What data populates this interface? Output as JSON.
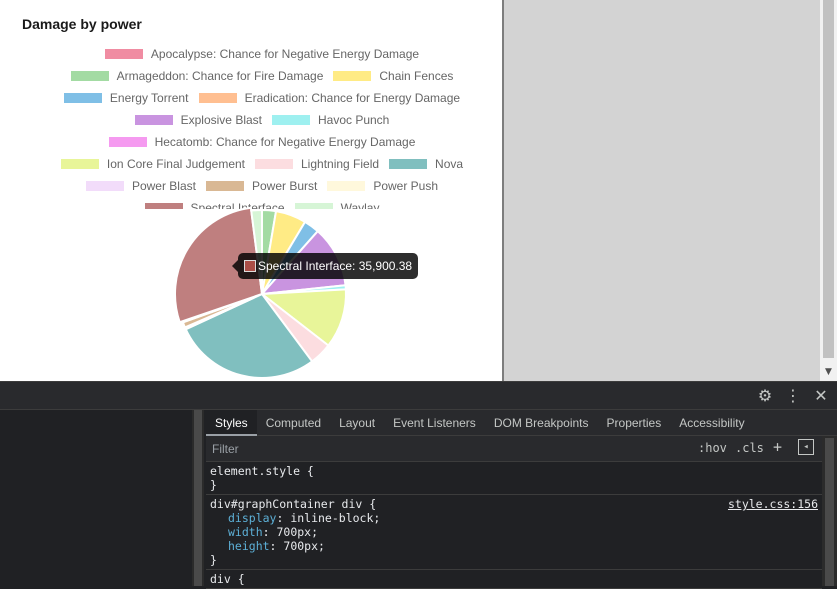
{
  "chart_data": {
    "type": "pie",
    "title": "Damage by power",
    "legend_placement": "top",
    "series": [
      {
        "name": "Apocalypse: Chance for Negative Energy Damage",
        "value": 0,
        "color": "#f08ca2"
      },
      {
        "name": "Armageddon: Chance for Fire Damage",
        "value": 3400,
        "color": "#a3dba3"
      },
      {
        "name": "Chain Fences",
        "value": 7500,
        "color": "#ffeb85"
      },
      {
        "name": "Energy Torrent",
        "value": 3800,
        "color": "#7fbfe6"
      },
      {
        "name": "Eradication: Chance for Energy Damage",
        "value": 0,
        "color": "#ffbf91"
      },
      {
        "name": "Explosive Blast",
        "value": 15000,
        "color": "#c994e0"
      },
      {
        "name": "Havoc Punch",
        "value": 1000,
        "color": "#9ef0f0"
      },
      {
        "name": "Hecatomb: Chance for Negative Energy Damage",
        "value": 0,
        "color": "#f59af0"
      },
      {
        "name": "Ion Core Final Judgement",
        "value": 14500,
        "color": "#e8f599"
      },
      {
        "name": "Lightning Field",
        "value": 5500,
        "color": "#fcdde0"
      },
      {
        "name": "Nova",
        "value": 36000,
        "color": "#80bfbf"
      },
      {
        "name": "Power Blast",
        "value": 500,
        "color": "#f2dcfa"
      },
      {
        "name": "Power Burst",
        "value": 1300,
        "color": "#d9b894"
      },
      {
        "name": "Power Push",
        "value": 300,
        "color": "#fff8dc"
      },
      {
        "name": "Spectral Interface",
        "value": 35900.38,
        "color": "#bf7f7f"
      },
      {
        "name": "Waylay",
        "value": 2600,
        "color": "#d6f5d6"
      }
    ],
    "tooltip": {
      "series": "Spectral Interface",
      "text": "Spectral Interface: 35,900.38"
    }
  },
  "devtools": {
    "tabs": [
      "Styles",
      "Computed",
      "Layout",
      "Event Listeners",
      "DOM Breakpoints",
      "Properties",
      "Accessibility"
    ],
    "active_tab": "Styles",
    "filter_placeholder": "Filter",
    "hov_label": ":hov",
    "cls_label": ".cls",
    "plus_label": "+",
    "rules": [
      {
        "selector": "element.style {",
        "close": "}",
        "props": []
      },
      {
        "selector": "div#graphContainer div {",
        "source": "style.css:156",
        "close": "}",
        "props": [
          {
            "name": "display",
            "value": "inline-block;"
          },
          {
            "name": "width",
            "value": "700px;"
          },
          {
            "name": "height",
            "value": "700px;"
          }
        ]
      },
      {
        "selector": "div {",
        "close": "",
        "props": []
      }
    ]
  }
}
